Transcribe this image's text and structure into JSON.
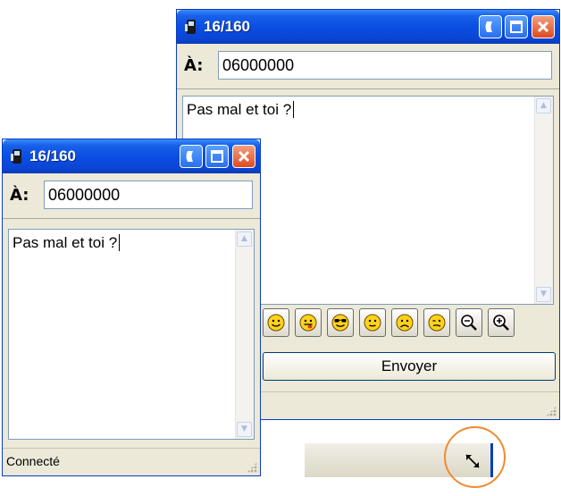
{
  "back_window": {
    "title": "16/160",
    "to_label": "À:",
    "to_value": "06000000",
    "message": "Pas mal et toi ?",
    "emoticons": [
      "smile-icon",
      "tongue-icon",
      "cool-icon",
      "neutral-icon",
      "sad-icon",
      "wink-icon"
    ],
    "zoom_out": "zoom-out-icon",
    "zoom_in": "zoom-in-icon",
    "send_label": "Envoyer"
  },
  "front_window": {
    "title": "16/160",
    "to_label": "À:",
    "to_value": "06000000",
    "message": "Pas mal et toi ?",
    "status": "Connecté"
  },
  "colors": {
    "titlebar": "#0a4ee4",
    "close_button": "#e04a20",
    "highlight_circle": "#f08a30",
    "window_bg": "#ece9d8"
  }
}
